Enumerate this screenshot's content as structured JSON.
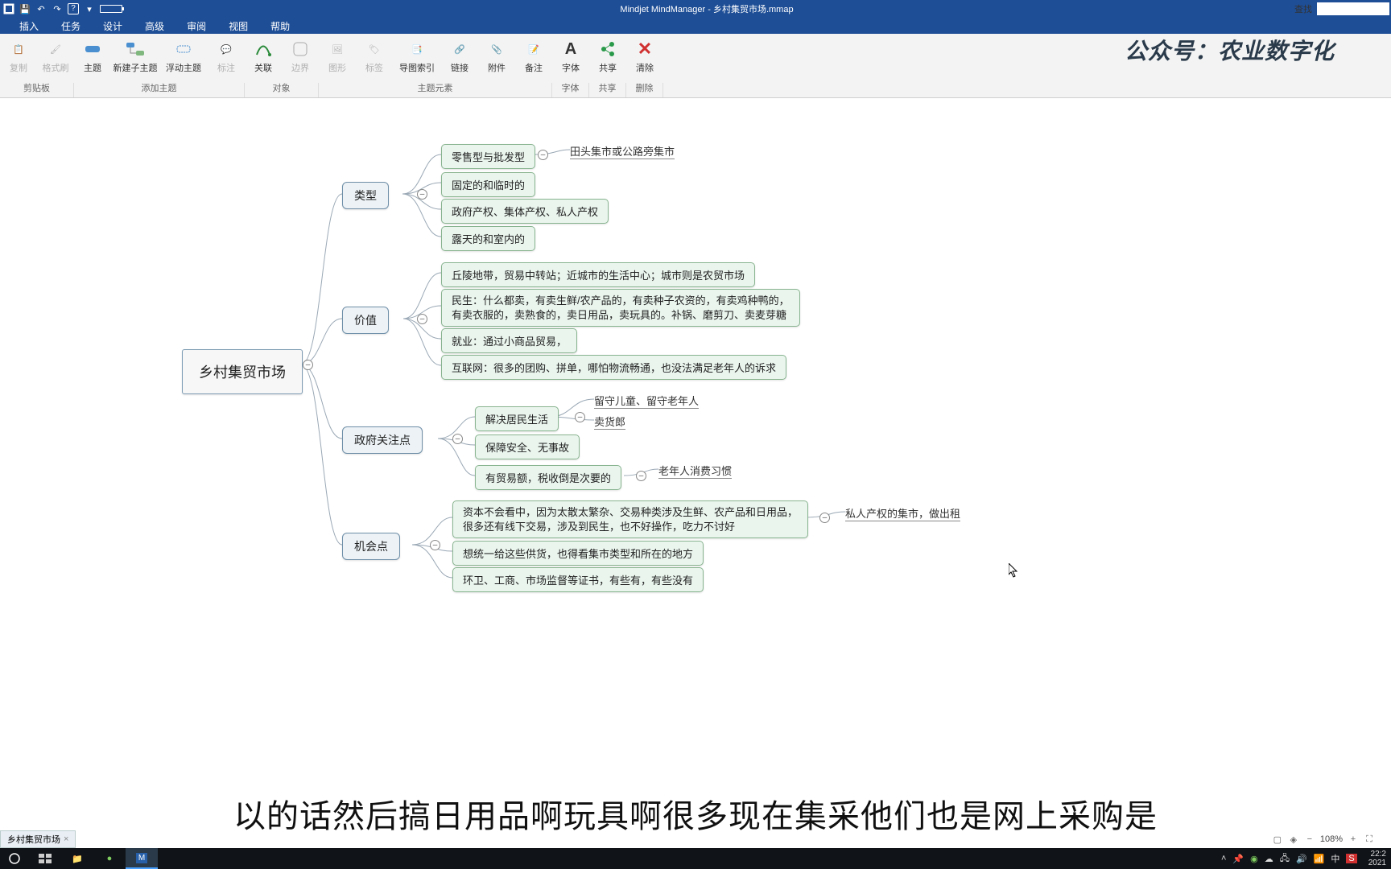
{
  "app": {
    "title_full": "Mindjet MindManager - 乡村集贸市场.mmap",
    "search_label": "查找"
  },
  "menu": [
    "插入",
    "任务",
    "设计",
    "高级",
    "审阅",
    "视图",
    "帮助"
  ],
  "ribbon": {
    "groups": {
      "clipboard": {
        "label": "剪贴板",
        "items": {
          "copy": "复制",
          "format": "格式刷"
        }
      },
      "addtopic": {
        "label": "添加主题",
        "items": {
          "topic": "主题",
          "newsub": "新建子主题",
          "float": "浮动主题",
          "marker": "标注"
        }
      },
      "object": {
        "label": "对象",
        "items": {
          "link": "关联",
          "border": "边界"
        }
      },
      "topicelem": {
        "label": "主题元素",
        "items": {
          "graphic": "图形",
          "tag": "标签",
          "navidx": "导图索引",
          "hyperlink": "链接",
          "attach": "附件",
          "note": "备注"
        }
      },
      "font": {
        "label": "字体",
        "items": {
          "font": "字体"
        }
      },
      "share": {
        "label": "共享",
        "items": {
          "share": "共享"
        }
      },
      "delete": {
        "label": "删除",
        "items": {
          "clear": "清除"
        }
      }
    }
  },
  "watermark": "公众号：农业数字化",
  "mindmap": {
    "root": "乡村集贸市场",
    "b1": {
      "title": "类型",
      "c1": "零售型与批发型",
      "c1n": "田头集市或公路旁集市",
      "c2": "固定的和临时的",
      "c3": "政府产权、集体产权、私人产权",
      "c4": "露天的和室内的"
    },
    "b2": {
      "title": "价值",
      "c1": "丘陵地带，贸易中转站；近城市的生活中心；城市则是农贸市场",
      "c2": "民生：什么都卖，有卖生鲜/农产品的，有卖种子农资的，有卖鸡种鸭的，\n有卖衣服的，卖熟食的，卖日用品，卖玩具的。补锅、磨剪刀、卖麦芽糖",
      "c3": "就业：通过小商品贸易，",
      "c4": "互联网：很多的团购、拼单，哪怕物流畅通，也没法满足老年人的诉求"
    },
    "b3": {
      "title": "政府关注点",
      "c1": "解决居民生活",
      "c1a": "留守儿童、留守老年人",
      "c1b": "卖货郎",
      "c2": "保障安全、无事故",
      "c3": "有贸易额，税收倒是次要的",
      "c3n": "老年人消费习惯"
    },
    "b4": {
      "title": "机会点",
      "c1": "资本不会看中，因为太散太繁杂、交易种类涉及生鲜、农产品和日用品，\n很多还有线下交易，涉及到民生，也不好操作，吃力不讨好",
      "c1n": "私人产权的集市，做出租",
      "c2": "想统一给这些供货，也得看集市类型和所在的地方",
      "c3": "环卫、工商、市场监督等证书，有些有，有些没有"
    }
  },
  "doc_tab": "乡村集贸市场",
  "zoom": "108%",
  "subtitle": "以的话然后搞日用品啊玩具啊很多现在集采他们也是网上采购是",
  "taskbar": {
    "clock_time": "22:2",
    "clock_date": "2021",
    "ime": "中"
  },
  "tray_icons": [
    "up",
    "pin",
    "nvidia",
    "net",
    "vol",
    "wifi",
    "ime",
    "sogou"
  ],
  "chart_data": {
    "type": "mindmap",
    "root": "乡村集贸市场",
    "children": [
      {
        "label": "类型",
        "children": [
          {
            "label": "零售型与批发型",
            "children": [
              {
                "label": "田头集市或公路旁集市"
              }
            ]
          },
          {
            "label": "固定的和临时的"
          },
          {
            "label": "政府产权、集体产权、私人产权"
          },
          {
            "label": "露天的和室内的"
          }
        ]
      },
      {
        "label": "价值",
        "children": [
          {
            "label": "丘陵地带，贸易中转站；近城市的生活中心；城市则是农贸市场"
          },
          {
            "label": "民生：什么都卖，有卖生鲜/农产品的，有卖种子农资的，有卖鸡种鸭的，有卖衣服的，卖熟食的，卖日用品，卖玩具的。补锅、磨剪刀、卖麦芽糖"
          },
          {
            "label": "就业：通过小商品贸易，"
          },
          {
            "label": "互联网：很多的团购、拼单，哪怕物流畅通，也没法满足老年人的诉求"
          }
        ]
      },
      {
        "label": "政府关注点",
        "children": [
          {
            "label": "解决居民生活",
            "children": [
              {
                "label": "留守儿童、留守老年人"
              },
              {
                "label": "卖货郎"
              }
            ]
          },
          {
            "label": "保障安全、无事故"
          },
          {
            "label": "有贸易额，税收倒是次要的",
            "children": [
              {
                "label": "老年人消费习惯"
              }
            ]
          }
        ]
      },
      {
        "label": "机会点",
        "children": [
          {
            "label": "资本不会看中，因为太散太繁杂、交易种类涉及生鲜、农产品和日用品，很多还有线下交易，涉及到民生，也不好操作，吃力不讨好",
            "children": [
              {
                "label": "私人产权的集市，做出租"
              }
            ]
          },
          {
            "label": "想统一给这些供货，也得看集市类型和所在的地方"
          },
          {
            "label": "环卫、工商、市场监督等证书，有些有，有些没有"
          }
        ]
      }
    ]
  }
}
